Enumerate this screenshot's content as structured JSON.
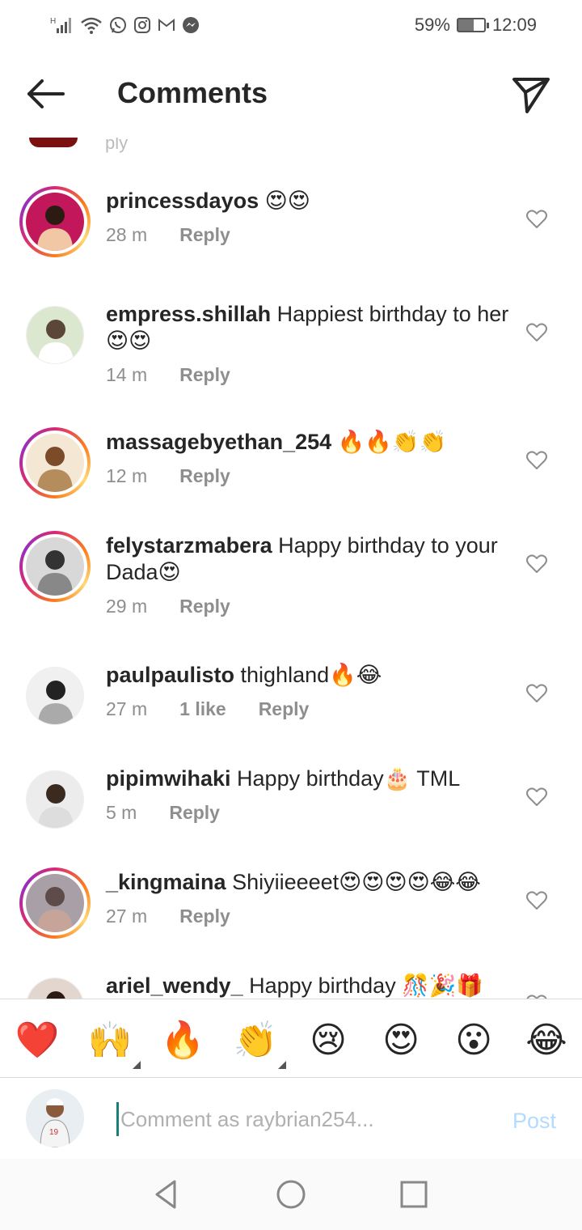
{
  "status_bar": {
    "network_label": "H",
    "battery_percent": "59%",
    "time": "12:09",
    "battery_level": 0.59
  },
  "header": {
    "title": "Comments"
  },
  "partial_top_comment": {
    "meta_fragment": "ply"
  },
  "comments": [
    {
      "username": "princessdayos",
      "text": " 😍😍",
      "time": "28 m",
      "likes": "",
      "reply": "Reply",
      "story_ring": true
    },
    {
      "username": "empress.shillah",
      "text": " Happiest birthday to her😍😍",
      "time": "14 m",
      "likes": "",
      "reply": "Reply",
      "story_ring": false
    },
    {
      "username": "massagebyethan_254",
      "text": " 🔥🔥👏👏",
      "time": "12 m",
      "likes": "",
      "reply": "Reply",
      "story_ring": true
    },
    {
      "username": "felystarzmabera",
      "text": " Happy birthday to your Dada😍",
      "time": "29 m",
      "likes": "",
      "reply": "Reply",
      "story_ring": true
    },
    {
      "username": "paulpaulisto",
      "text": " thighland🔥😂",
      "time": "27 m",
      "likes": "1 like",
      "reply": "Reply",
      "story_ring": false
    },
    {
      "username": "pipimwihaki",
      "text": " Happy birthday🎂 TML",
      "time": "5 m",
      "likes": "",
      "reply": "Reply",
      "story_ring": false
    },
    {
      "username": "_kingmaina",
      "text": " Shiyiieeeet😍😍😍😍😂😂",
      "time": "27 m",
      "likes": "",
      "reply": "Reply",
      "story_ring": true
    },
    {
      "username": "ariel_wendy_",
      "text": " Happy birthday 🎊🎉🎁",
      "time": "",
      "likes": "",
      "reply": "",
      "story_ring": false
    }
  ],
  "emoji_bar": [
    {
      "emoji": "❤️",
      "icon": "red-heart-icon",
      "has_tones": false
    },
    {
      "emoji": "🙌",
      "icon": "raising-hands-icon",
      "has_tones": true
    },
    {
      "emoji": "🔥",
      "icon": "fire-icon",
      "has_tones": false
    },
    {
      "emoji": "👏",
      "icon": "clapping-hands-icon",
      "has_tones": true
    },
    {
      "emoji": "😢",
      "icon": "crying-face-icon",
      "has_tones": false
    },
    {
      "emoji": "😍",
      "icon": "heart-eyes-icon",
      "has_tones": false
    },
    {
      "emoji": "😮",
      "icon": "surprised-face-icon",
      "has_tones": false
    },
    {
      "emoji": "😂",
      "icon": "tears-of-joy-icon",
      "has_tones": false
    }
  ],
  "composer": {
    "placeholder": "Comment as raybrian254...",
    "post_label": "Post"
  },
  "colors": {
    "accent_link": "#b3dbff",
    "meta_gray": "#8e8e8e",
    "text": "#262626"
  }
}
